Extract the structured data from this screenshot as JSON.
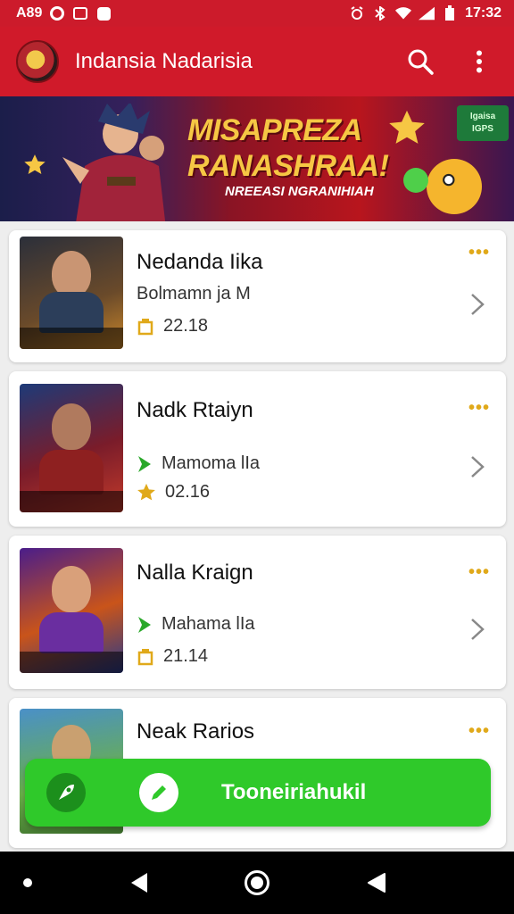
{
  "status_bar": {
    "left_text": "A89",
    "time": "17:32",
    "icons": [
      "circle-icon",
      "box-icon",
      "dot-icon",
      "alarm-icon",
      "bluetooth-icon",
      "wifi-icon",
      "signal-icon",
      "battery-icon"
    ]
  },
  "app_bar": {
    "title": "Indansia Nadarisia",
    "icons": [
      "search-icon",
      "more-vert-icon"
    ]
  },
  "banner": {
    "title_line1": "MISAPREZA",
    "title_line2": "RANASHRAA!",
    "subtitle": "NREEASI NGRANIHIAH",
    "badge": "Igaisa\nIGPS"
  },
  "games": [
    {
      "name": "Nedanda Iika",
      "sub": "Bolmamn ja M",
      "rating": "22.18",
      "rating_icon": "badge-icon"
    },
    {
      "name": "Nadk Rtaiyn",
      "sub": "Mamoma lIa",
      "rating": "02.16",
      "rating_icon": "star-icon"
    },
    {
      "name": "Nalla Kraign",
      "sub": "Mahama lIa",
      "rating": "21.14",
      "rating_icon": "badge-icon"
    },
    {
      "name": "Neak Rarios",
      "sub": "",
      "rating": "",
      "rating_icon": ""
    }
  ],
  "fab": {
    "label": "Tooneiriahukil"
  },
  "colors": {
    "brand_red": "#cc1b2b",
    "accent_green": "#2fc92a",
    "gold": "#e0a91a"
  }
}
